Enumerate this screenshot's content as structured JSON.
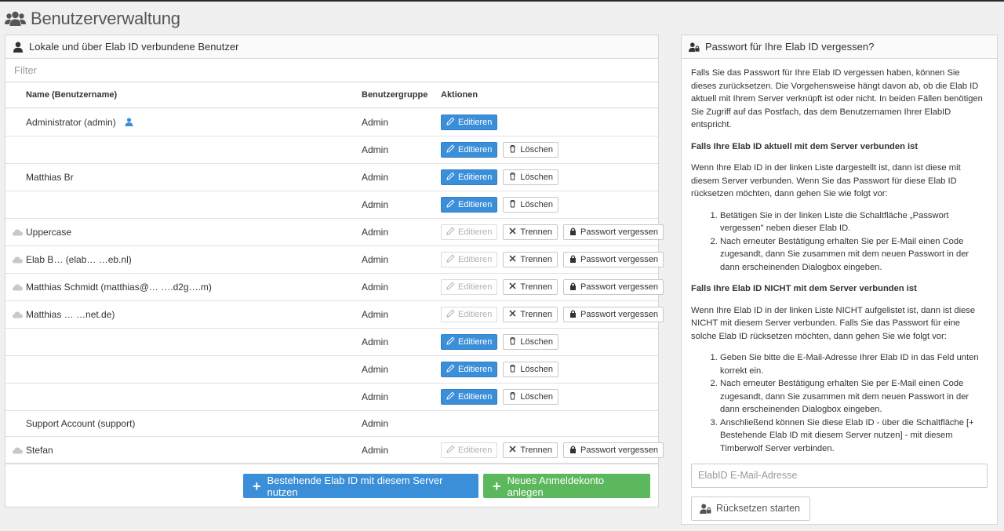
{
  "page": {
    "title": "Benutzerverwaltung"
  },
  "users_panel": {
    "title": "Lokale und über Elab ID verbundene Benutzer",
    "filter_placeholder": "Filter",
    "columns": {
      "name": "Name (Benutzername)",
      "group": "Benutzergruppe",
      "actions": "Aktionen"
    },
    "button_labels": {
      "edit": "Editieren",
      "delete": "Löschen",
      "disconnect": "Trennen",
      "forgot": "Passwort vergessen"
    },
    "rows": [
      {
        "name": "Administrator (admin)",
        "group": "Admin",
        "elab": false,
        "current_user": true
      },
      {
        "name": "",
        "group": "Admin",
        "elab": false
      },
      {
        "name": "Matthias Br",
        "group": "Admin",
        "elab": false
      },
      {
        "name": "",
        "group": "Admin",
        "elab": false
      },
      {
        "name": "Uppercase",
        "group": "Admin",
        "elab": true
      },
      {
        "name": "Elab B…  (elab…  …eb.nl)",
        "group": "Admin",
        "elab": true
      },
      {
        "name": "Matthias Schmidt (matthias@… ….d2g….m)",
        "group": "Admin",
        "elab": true
      },
      {
        "name": "Matthias … …net.de)",
        "group": "Admin",
        "elab": true
      },
      {
        "name": "",
        "group": "Admin",
        "elab": false
      },
      {
        "name": "",
        "group": "Admin",
        "elab": false
      },
      {
        "name": "",
        "group": "Admin",
        "elab": false
      },
      {
        "name": "Support Account (support)",
        "group": "Admin",
        "elab": false,
        "no_actions": true
      },
      {
        "name": "Stefan",
        "group": "Admin",
        "elab": true
      }
    ],
    "footer": {
      "use_existing": "Bestehende Elab ID mit diesem Server nutzen",
      "new_account": "Neues Anmeldekonto anlegen"
    }
  },
  "forgot_panel": {
    "title": "Passwort für Ihre Elab ID vergessen?",
    "intro": "Falls Sie das Passwort für Ihre Elab ID vergessen haben, können Sie dieses zurücksetzen. Die Vorgehensweise hängt davon ab, ob die Elab ID aktuell mit Ihrem Server verknüpft ist oder nicht. In beiden Fällen benötigen Sie Zugriff auf das Postfach, das dem Benutzernamen Ihrer ElabID entspricht.",
    "connected_heading": "Falls Ihre Elab ID aktuell mit dem Server verbunden ist",
    "connected_text": "Wenn Ihre Elab ID in der linken Liste dargestellt ist, dann ist diese mit diesem Server verbunden. Wenn Sie das Passwort für diese Elab ID rücksetzen möchten, dann gehen Sie wie folgt vor:",
    "connected_steps": [
      "Betätigen Sie in der linken Liste die Schaltfläche „Passwort vergessen\" neben dieser Elab ID.",
      "Nach erneuter Bestätigung erhalten Sie per E-Mail einen Code zugesandt, dann Sie zusammen mit dem neuen Passwort in der dann erscheinenden Dialogbox eingeben."
    ],
    "not_connected_heading": "Falls Ihre Elab ID NICHT mit dem Server verbunden ist",
    "not_connected_text": "Wenn Ihre Elab ID in der linken Liste NICHT aufgelistet ist, dann ist diese NICHT mit diesem Server verbunden. Falls Sie das Passwort für eine solche Elab ID rücksetzen möchten, dann gehen Sie wie folgt vor:",
    "not_connected_steps": [
      "Geben Sie bitte die E-Mail-Adresse Ihrer Elab ID in das Feld unten korrekt ein.",
      "Nach erneuter Bestätigung erhalten Sie per E-Mail einen Code zugesandt, dann Sie zusammen mit dem neuen Passwort in der dann erscheinenden Dialogbox eingeben.",
      "Anschließend können Sie diese Elab ID - über die Schaltfläche [+ Bestehende Elab ID mit diesem Server nutzen] - mit diesem Timberwolf Server verbinden."
    ],
    "email_placeholder": "ElabID E-Mail-Adresse",
    "reset_button": "Rücksetzen starten"
  },
  "colors": {
    "primary": "#3b8ed8",
    "success": "#5cb85c",
    "current_user_icon": "#3b8ed8",
    "cloud_icon": "#c8c8c8"
  }
}
